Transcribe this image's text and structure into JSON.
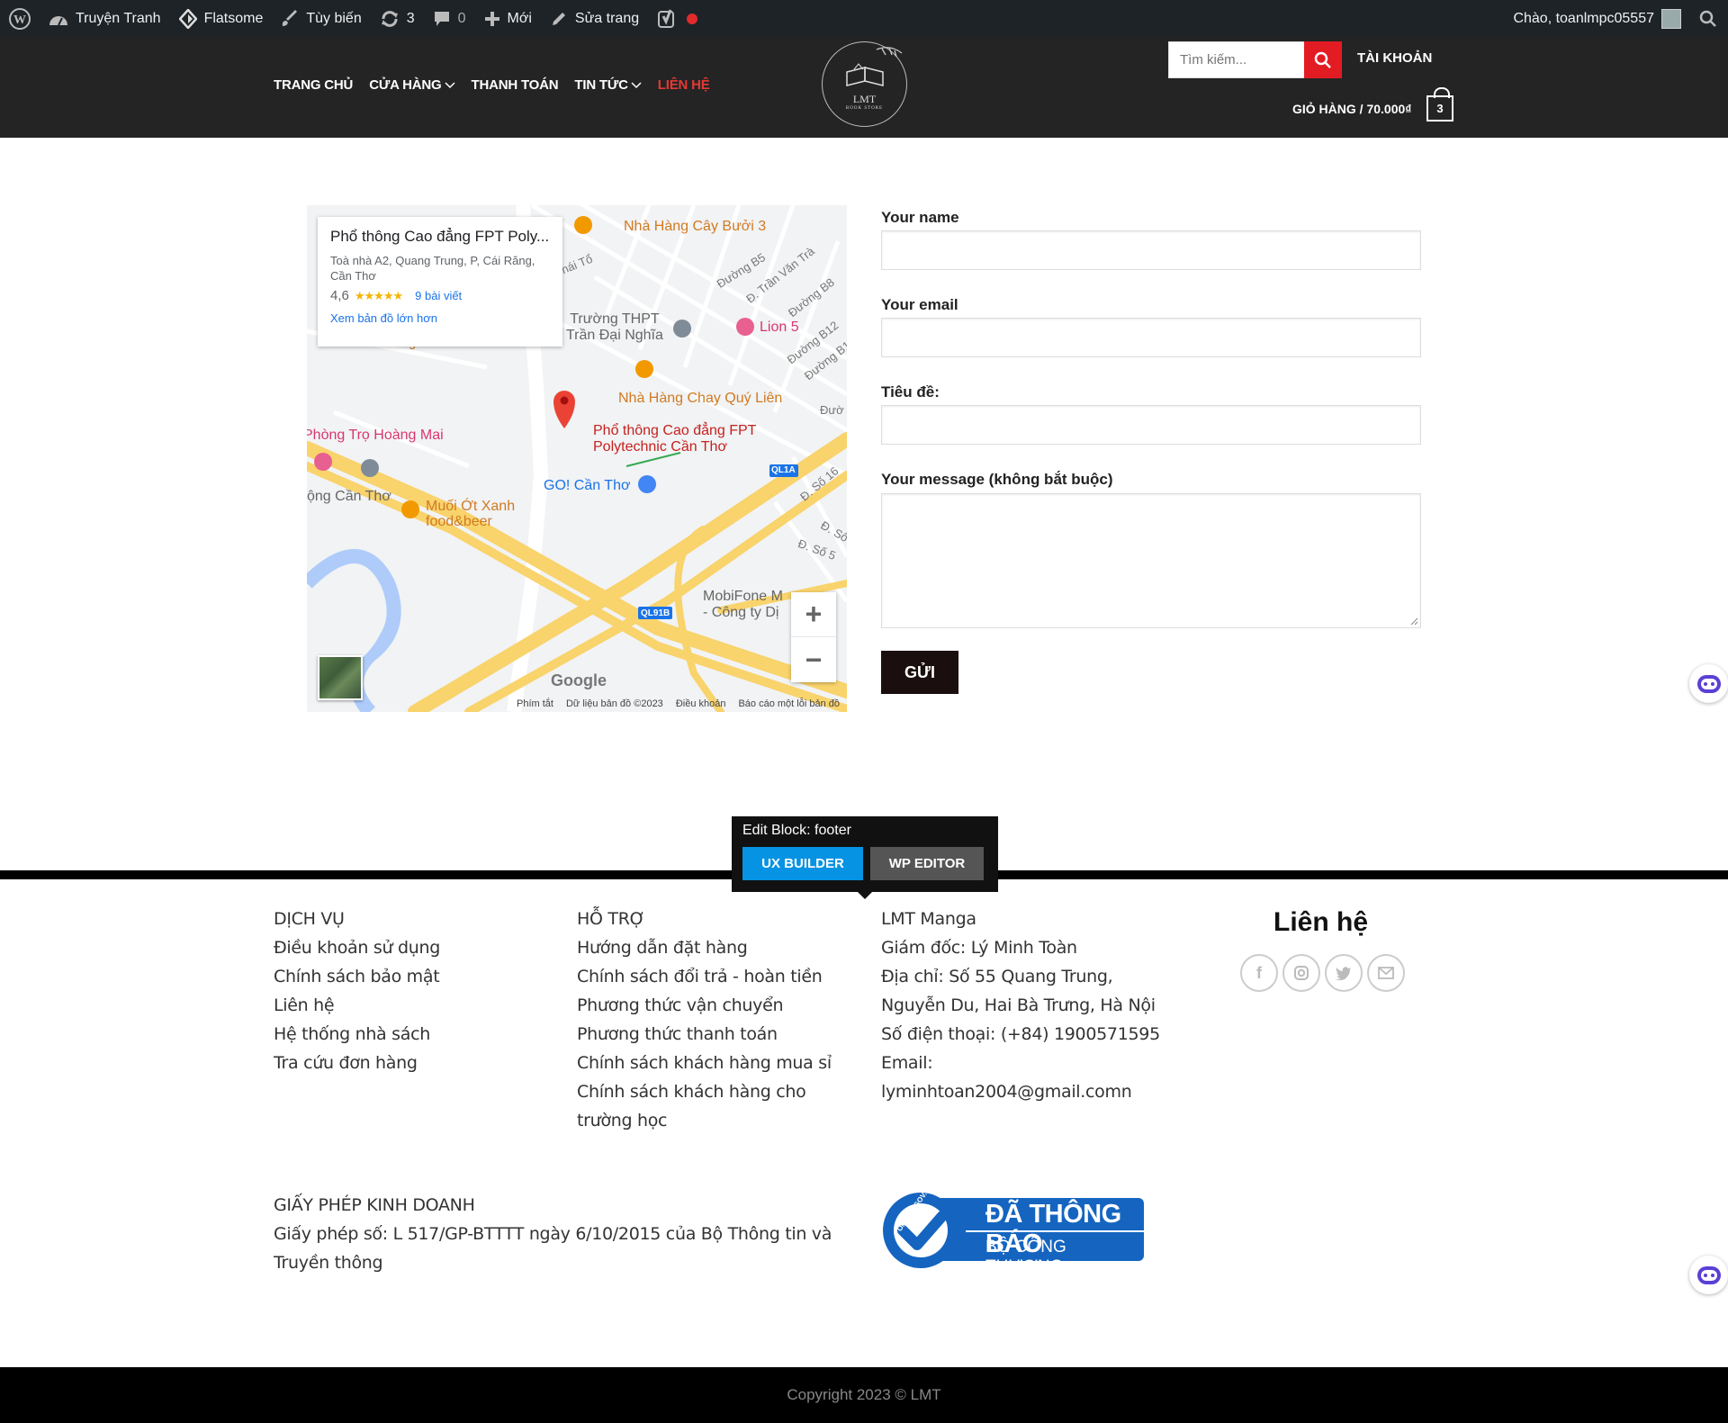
{
  "admin_bar": {
    "site_name": "Truyện Tranh",
    "theme": "Flatsome",
    "customize": "Tùy biến",
    "updates_count": "3",
    "comments_count": "0",
    "new_label": "Mới",
    "edit_page": "Sửa trang",
    "greeting": "Chào, toanlmpc05557"
  },
  "header": {
    "nav": [
      {
        "label": "TRANG CHỦ"
      },
      {
        "label": "CỬA HÀNG"
      },
      {
        "label": "THANH TOÁN"
      },
      {
        "label": "TIN TỨC"
      },
      {
        "label": "LIÊN HỆ"
      }
    ],
    "logo_text": "LMT",
    "logo_sub": "BOOK STORE",
    "search_placeholder": "Tìm kiếm...",
    "account": "TÀI KHOẢN",
    "cart_label": "GIỎ HÀNG / 70.000₫",
    "cart_count": "3"
  },
  "map": {
    "place_title": "Phổ thông Cao đẳng FPT Poly...",
    "place_address": "Toà nhà A2, Quang Trung, P, Cái Răng, Cần Thơ",
    "rating": "4,6",
    "stars": "★★★★★",
    "reviews": "9 bài viết",
    "larger_map": "Xem bản đồ lớn hơn",
    "labels": {
      "cay_buoi": "Nhà Hàng Cây Bưởi 3",
      "thai_to": "hái Tổ",
      "duong_b5": "Đường B5",
      "tran_van_tra": "Đ. Trần Văn Trà",
      "duong_b8": "Đường B8",
      "tran_dai_nghia": "Trường THPT\nTrần Đại Nghĩa",
      "lion5": "Lion 5",
      "duong_b12": "Đường B12",
      "duong_b1": "Đường B1",
      "massage": "Massage Tố Châu",
      "chay_quy_lien": "Nhà Hàng Chay Quý Liên",
      "duong": "Đườ",
      "hoang_mai": "Phòng Trọ Hoàng Mai",
      "fpt_pin_1": "Phổ thông Cao đẳng FPT",
      "fpt_pin_2": "Polytechnic Cần Thơ",
      "ql1a": "QL1A",
      "so16": "Đ. Số 16",
      "go_can_tho": "GO! Cần Thơ",
      "ong_can_tho": "ộng Cần Thơ",
      "muoi_ot_1": "Muối Ớt Xanh",
      "muoi_ot_2": "food&beer",
      "so_a": "Đ. Số",
      "so5": "Đ. Số 5",
      "mobifone_1": "MobiFone M",
      "mobifone_2": "- Công ty Dị",
      "ql91b": "QL91B"
    },
    "google": "Google",
    "footer_links": [
      "Phím tắt",
      "Dữ liệu bản đồ ©2023",
      "Điều khoản",
      "Báo cáo một lỗi bản đồ"
    ]
  },
  "form": {
    "name_label": "Your name",
    "email_label": "Your email",
    "subject_label": "Tiêu đề:",
    "message_label": "Your message (không bắt buộc)",
    "submit": "GỬI"
  },
  "edit_block": {
    "title": "Edit Block: footer",
    "ux_builder": "UX BUILDER",
    "wp_editor": "WP EDITOR"
  },
  "footer": {
    "services": {
      "heading": "DỊCH VỤ",
      "items": [
        "Điều khoản sử dụng",
        "Chính sách bảo mật",
        "Liên hệ",
        "Hệ thống nhà sách",
        "Tra cứu đơn hàng"
      ]
    },
    "support": {
      "heading": "HỖ TRỢ",
      "items": [
        "Hướng dẫn đặt hàng",
        "Chính sách đổi trả - hoàn tiền",
        "Phương thức vận chuyển",
        "Phương thức thanh toán",
        "Chính sách khách hàng mua sỉ",
        "Chính sách khách hàng cho",
        "trường học"
      ]
    },
    "company": {
      "heading": "LMT Manga",
      "items": [
        "Giám đốc: Lý Minh Toàn",
        "Địa chỉ: Số 55 Quang Trung,",
        "Nguyễn Du, Hai Bà Trưng, Hà Nội",
        "Số điện thoại: (+84) 1900571595",
        "Email:",
        "lyminhtoan2004@gmail.comn"
      ]
    },
    "contact_title": "Liên hệ",
    "license": {
      "heading": "GIẤY PHÉP KINH DOANH",
      "line1": "Giấy phép số: L 517/GP-BTTTT ngày 6/10/2015 của Bộ Thông tin và",
      "line2": "Truyền thông"
    },
    "badge": {
      "line1": "ĐÃ THÔNG BÁO",
      "line2": "BỘ CÔNG THƯƠNG",
      "ring": "ONLINE.GOV.VN"
    },
    "copyright": "Copyright 2023 © LMT"
  }
}
